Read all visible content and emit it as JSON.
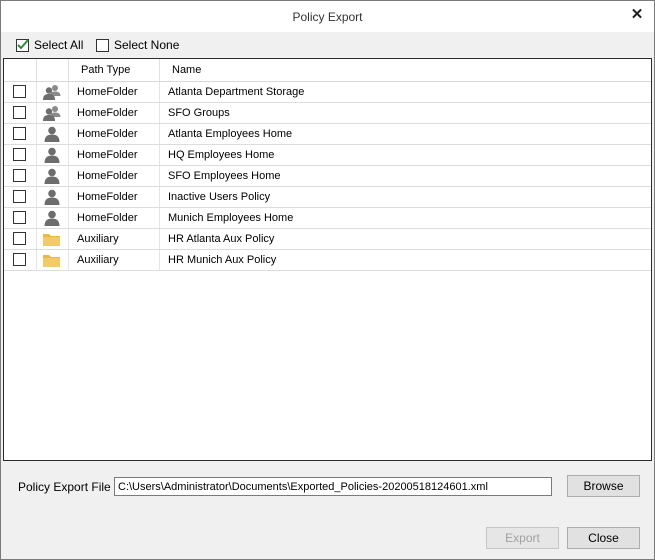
{
  "window": {
    "title": "Policy Export"
  },
  "selection": {
    "select_all_label": "Select All",
    "select_all_checked": true,
    "select_none_label": "Select None",
    "select_none_checked": false
  },
  "table": {
    "columns": [
      "",
      "",
      "Path Type",
      "Name"
    ],
    "rows": [
      {
        "icon": "group-icon",
        "path_type": "HomeFolder",
        "name": "Atlanta Department Storage",
        "checked": false
      },
      {
        "icon": "group-icon",
        "path_type": "HomeFolder",
        "name": "SFO Groups",
        "checked": false
      },
      {
        "icon": "user-icon",
        "path_type": "HomeFolder",
        "name": "Atlanta Employees Home",
        "checked": false
      },
      {
        "icon": "user-icon",
        "path_type": "HomeFolder",
        "name": "HQ Employees Home",
        "checked": false
      },
      {
        "icon": "user-icon",
        "path_type": "HomeFolder",
        "name": "SFO Employees Home",
        "checked": false
      },
      {
        "icon": "user-icon",
        "path_type": "HomeFolder",
        "name": "Inactive Users Policy",
        "checked": false
      },
      {
        "icon": "user-icon",
        "path_type": "HomeFolder",
        "name": "Munich Employees Home",
        "checked": false
      },
      {
        "icon": "folder-icon",
        "path_type": "Auxiliary",
        "name": "HR Atlanta Aux Policy",
        "checked": false
      },
      {
        "icon": "folder-icon",
        "path_type": "Auxiliary",
        "name": "HR Munich Aux Policy",
        "checked": false
      }
    ]
  },
  "export_file": {
    "label": "Policy Export File",
    "value": "C:\\Users\\Administrator\\Documents\\Exported_Policies-20200518124601.xml"
  },
  "buttons": {
    "browse": "Browse",
    "export": "Export",
    "close": "Close"
  },
  "colors": {
    "check_green": "#2e8b3a",
    "icon_gray": "#6d6d6d",
    "folder_yellow": "#e8b84a"
  }
}
